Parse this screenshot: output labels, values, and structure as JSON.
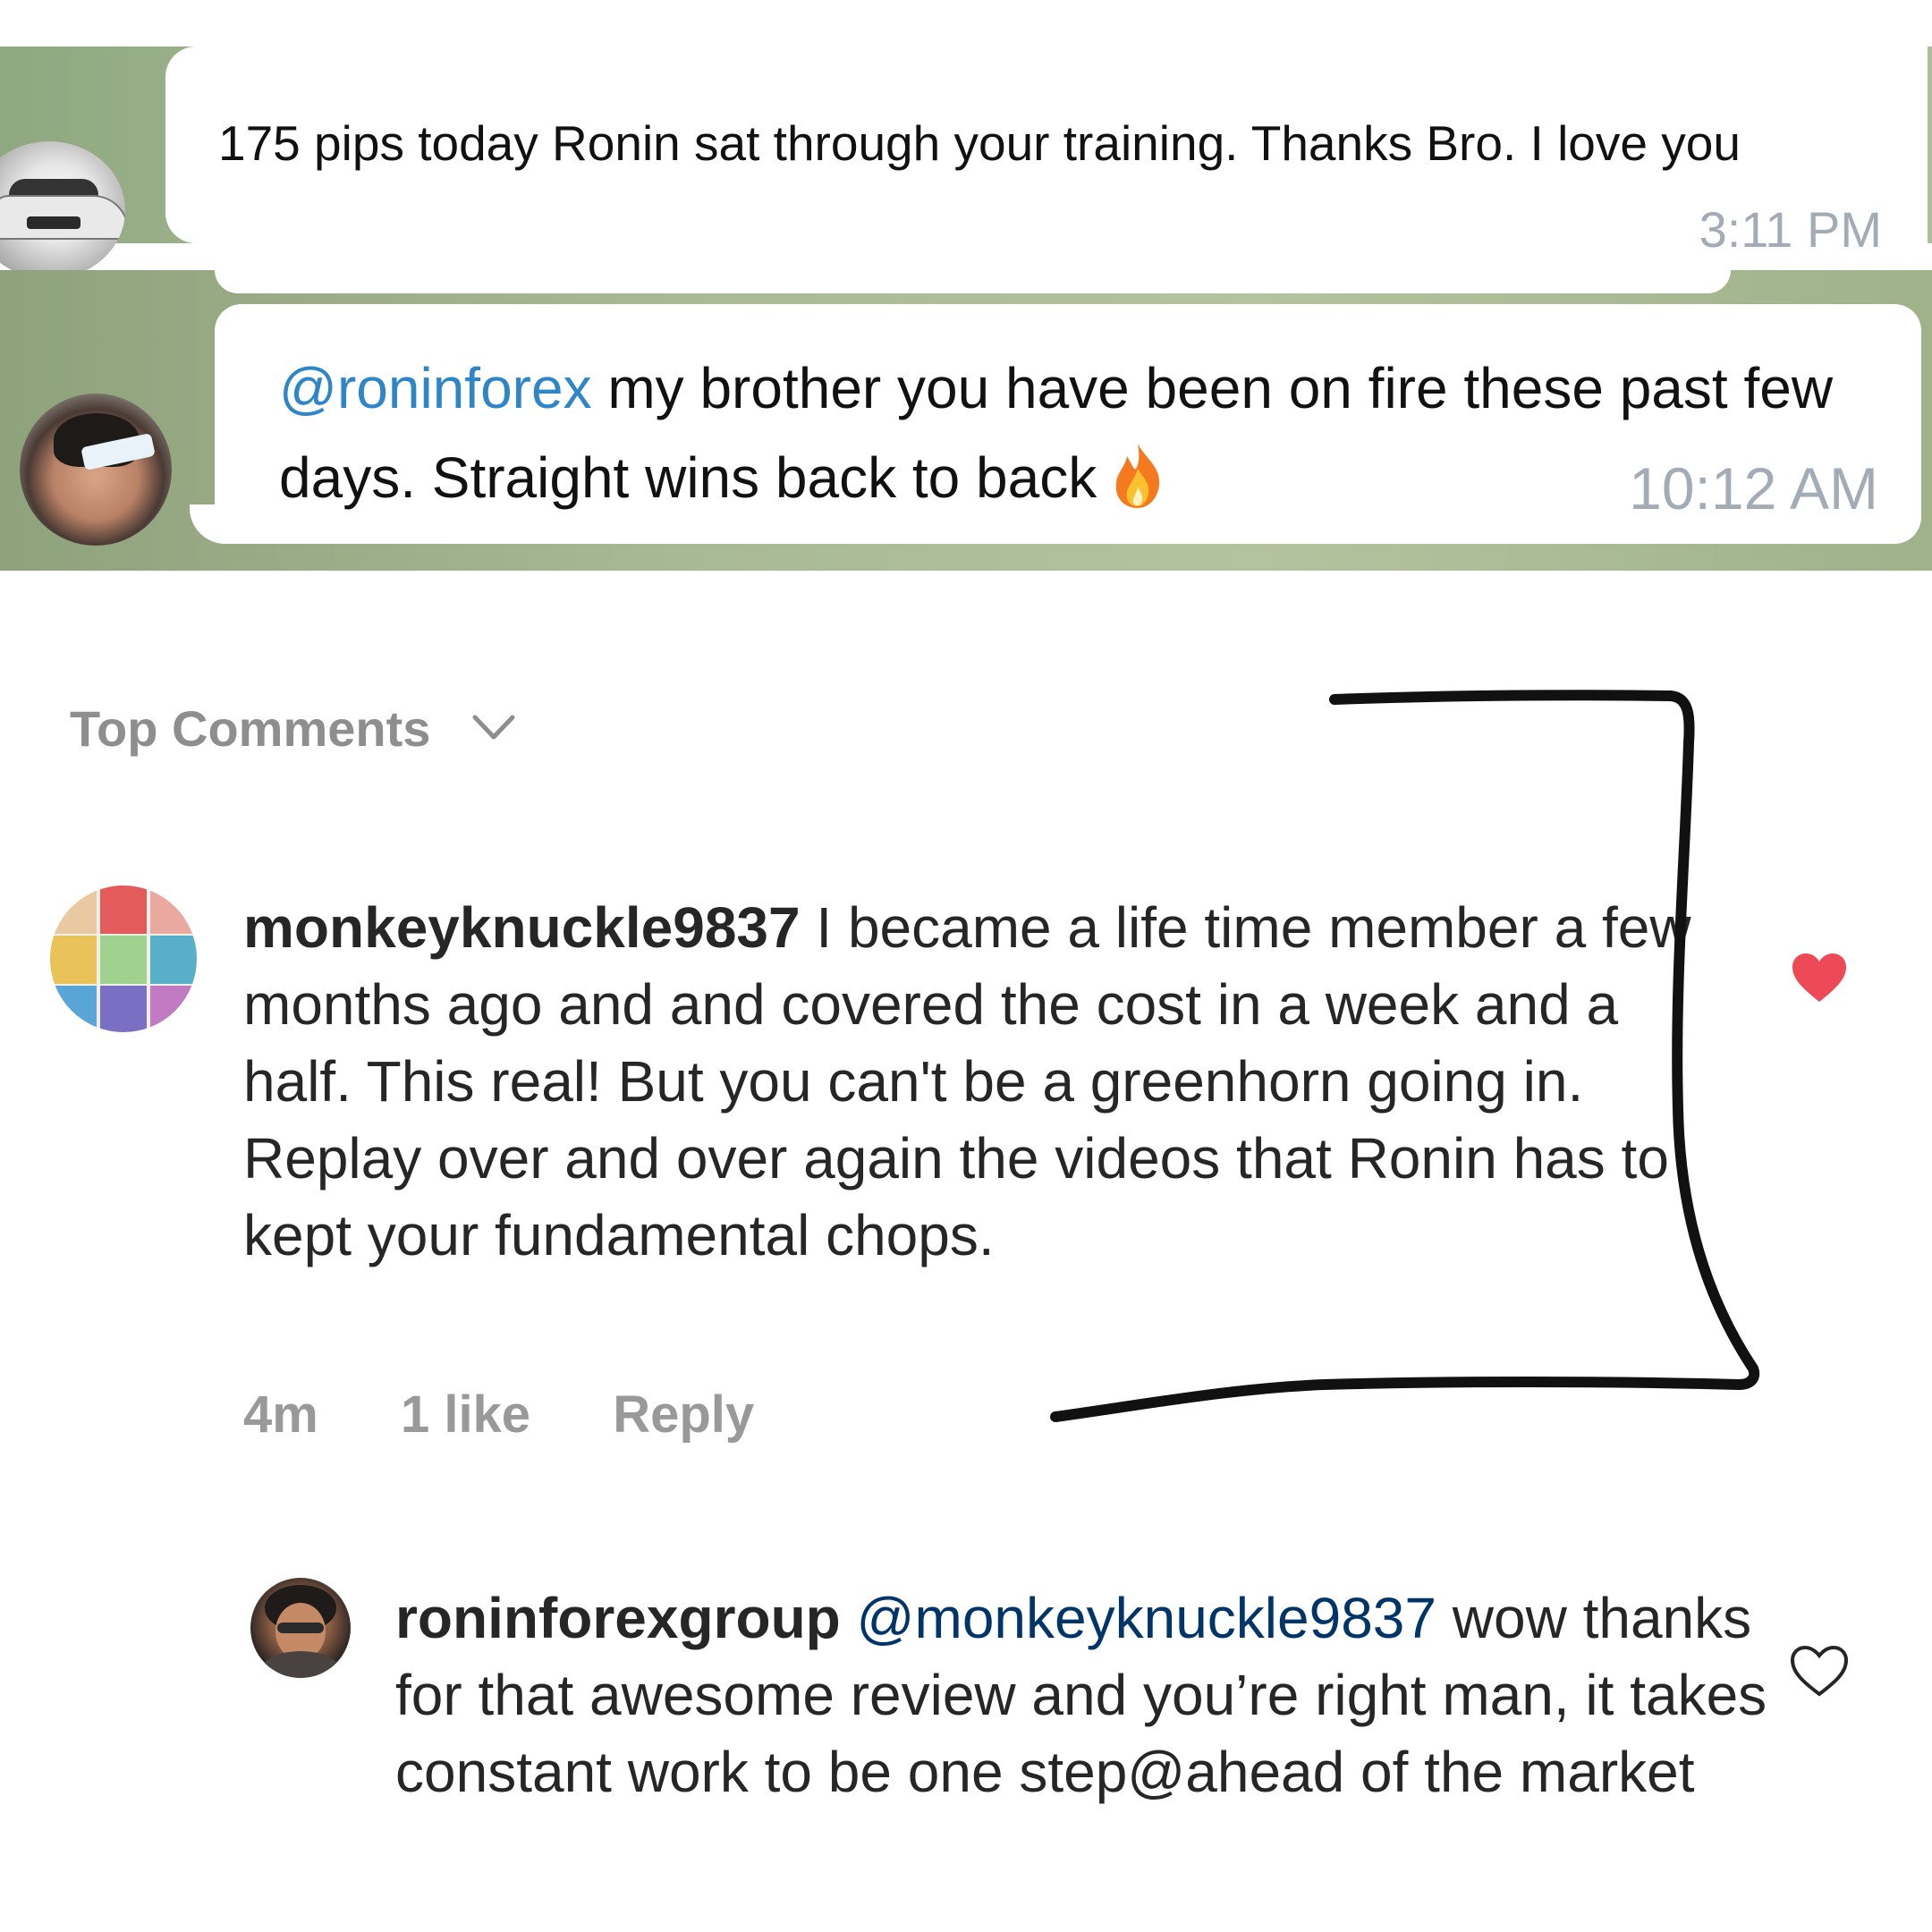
{
  "telegram": {
    "message1": {
      "text": "175 pips today Ronin sat through your training. Thanks Bro. I love you",
      "time": "3:11 PM"
    },
    "message2": {
      "mention": "@roninforex",
      "text": " my brother you have been on fire these past few days. Straight wins back to back",
      "emoji": "fire-icon",
      "time": "10:12 AM"
    }
  },
  "instagram": {
    "section_label": "Top Comments",
    "comment1": {
      "username": "monkeyknuckle9837",
      "text": " I became a life time member a few months ago and and covered the cost in a week and a half. This real! But you can't be a greenhorn going in. Replay over and over again the videos that Ronin has to kept your fundamental chops.",
      "age": "4m",
      "likes": "1 like",
      "reply_label": "Reply",
      "liked": true
    },
    "comment2": {
      "username": "roninforexgroup",
      "mention": "@monkeyknuckle9837",
      "text": "wow thanks for that awesome review and you’re right man, it takes constant work to be one step@ahead of the market",
      "liked": false
    }
  },
  "colors": {
    "telegram_link": "#2e86c8",
    "telegram_time": "#a3acb6",
    "ig_heart": "#ed4956",
    "ig_meta": "#999999",
    "ig_text": "#262626"
  }
}
